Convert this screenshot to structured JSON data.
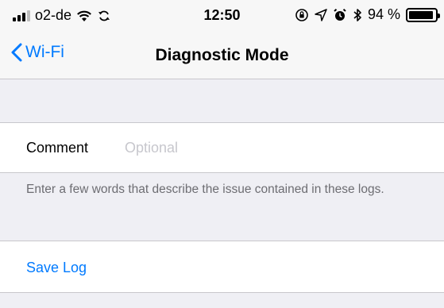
{
  "status_bar": {
    "carrier": "o2-de",
    "time": "12:50",
    "battery_text": "94 %",
    "battery_level": 0.94
  },
  "nav": {
    "back_label": "Wi-Fi",
    "title": "Diagnostic Mode"
  },
  "form": {
    "comment_label": "Comment",
    "comment_placeholder": "Optional",
    "comment_value": "",
    "footer": "Enter a few words that describe the issue contained in these logs."
  },
  "actions": {
    "save_label": "Save Log"
  },
  "colors": {
    "accent": "#007aff",
    "background": "#efeff4",
    "secondary_text": "#6d6d72"
  }
}
